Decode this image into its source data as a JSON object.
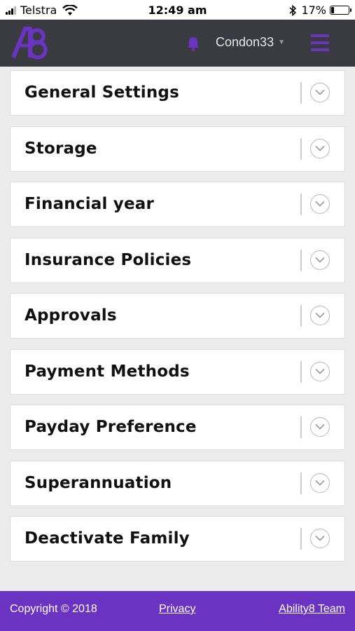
{
  "status_bar": {
    "carrier": "Telstra",
    "time": "12:49 am",
    "battery_percent": "17%",
    "battery_level": 0.17,
    "icons": [
      "signal-icon",
      "wifi-icon",
      "bluetooth-icon",
      "battery-icon"
    ]
  },
  "header": {
    "logo": "A8",
    "username": "Condon33",
    "icons": [
      "bell-icon",
      "chevron-down-icon",
      "hamburger-menu-icon"
    ]
  },
  "sections": [
    {
      "title": "General Settings"
    },
    {
      "title": "Storage"
    },
    {
      "title": "Financial year"
    },
    {
      "title": "Insurance Policies"
    },
    {
      "title": "Approvals"
    },
    {
      "title": "Payment Methods"
    },
    {
      "title": "Payday Preference"
    },
    {
      "title": "Superannuation"
    },
    {
      "title": "Deactivate Family"
    }
  ],
  "footer": {
    "copyright": "Copyright © 2018",
    "privacy": "Privacy",
    "team": "Ability8 Team"
  },
  "colors": {
    "brand_purple": "#6a33c2",
    "header_bg": "#3a3b40",
    "page_bg": "#ececec"
  }
}
